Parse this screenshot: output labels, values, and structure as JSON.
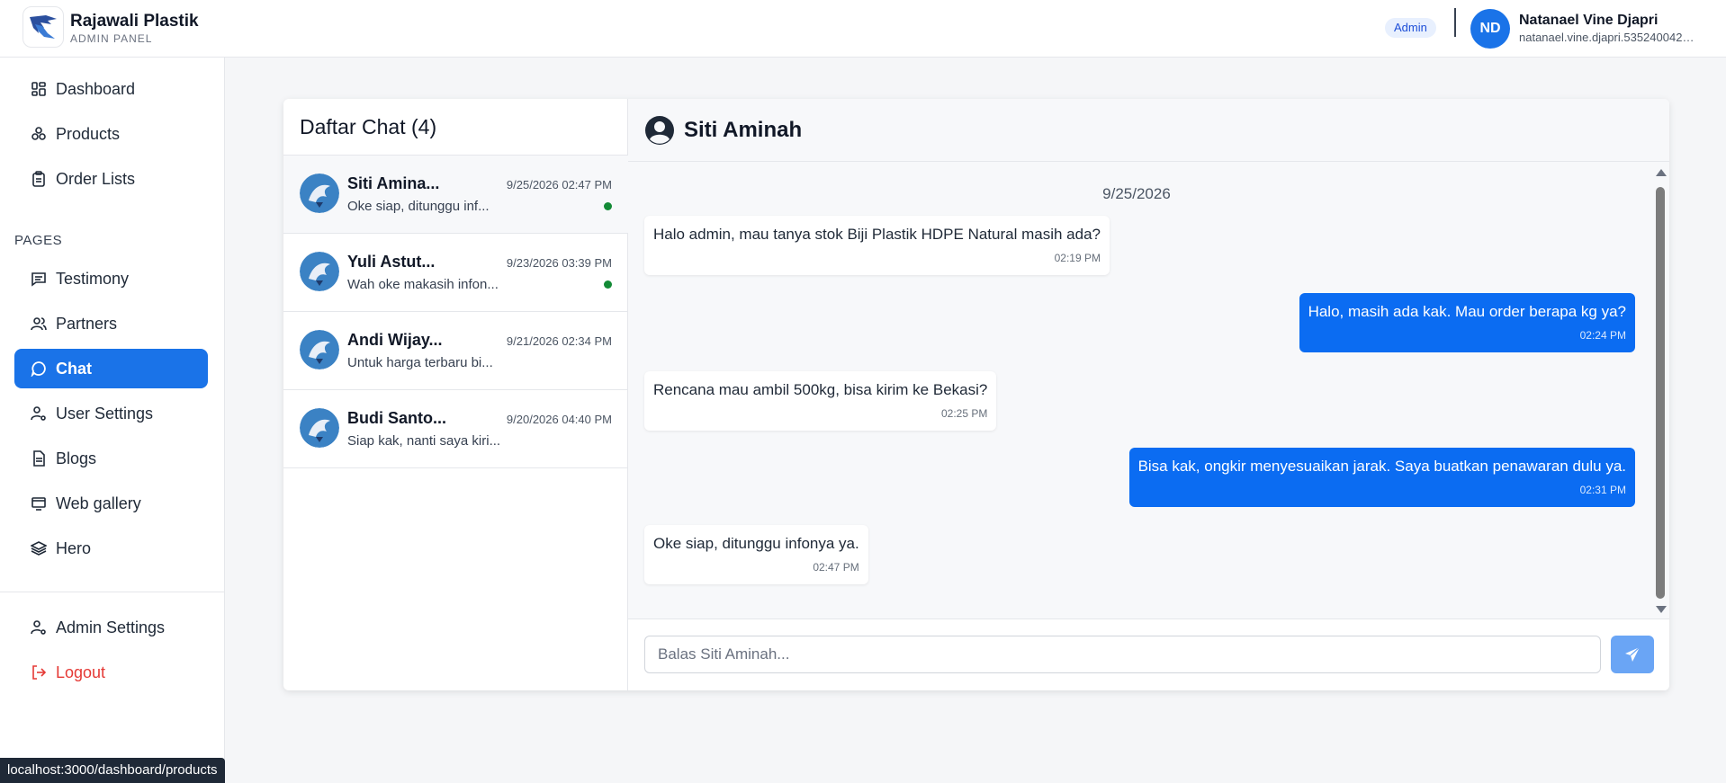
{
  "header": {
    "brand_name": "Rajawali Plastik",
    "brand_sub": "ADMIN PANEL",
    "role_badge": "Admin",
    "user_initials": "ND",
    "user_name": "Natanael Vine Djapri",
    "user_email": "natanael.vine.djapri.535240042@..."
  },
  "sidebar": {
    "main_items": [
      {
        "label": "Dashboard",
        "icon": "dashboard-icon"
      },
      {
        "label": "Products",
        "icon": "products-icon"
      },
      {
        "label": "Order Lists",
        "icon": "clipboard-icon"
      }
    ],
    "section_label": "PAGES",
    "page_items": [
      {
        "label": "Testimony",
        "icon": "message-square-icon"
      },
      {
        "label": "Partners",
        "icon": "users-icon"
      },
      {
        "label": "Chat",
        "icon": "chat-bubble-icon",
        "active": true
      },
      {
        "label": "User Settings",
        "icon": "user-cog-icon"
      },
      {
        "label": "Blogs",
        "icon": "document-icon"
      },
      {
        "label": "Web gallery",
        "icon": "monitor-icon"
      },
      {
        "label": "Hero",
        "icon": "layers-icon"
      }
    ],
    "bottom_items": [
      {
        "label": "Admin Settings",
        "icon": "user-cog-icon"
      },
      {
        "label": "Logout",
        "icon": "logout-icon"
      }
    ]
  },
  "chat_list": {
    "title": "Daftar Chat (4)",
    "items": [
      {
        "name": "Siti Amina...",
        "time": "9/25/2026 02:47 PM",
        "preview": "Oke siap, ditunggu inf...",
        "unread": true,
        "selected": true
      },
      {
        "name": "Yuli Astut...",
        "time": "9/23/2026 03:39 PM",
        "preview": "Wah oke makasih infon...",
        "unread": true,
        "selected": false
      },
      {
        "name": "Andi Wijay...",
        "time": "9/21/2026 02:34 PM",
        "preview": "Untuk harga terbaru bi...",
        "unread": false,
        "selected": false
      },
      {
        "name": "Budi Santo...",
        "time": "9/20/2026 04:40 PM",
        "preview": "Siap kak, nanti saya kiri...",
        "unread": false,
        "selected": false
      }
    ]
  },
  "conversation": {
    "title": "Siti Aminah",
    "date": "9/25/2026",
    "messages": [
      {
        "direction": "in",
        "text": "Halo admin, mau tanya stok Biji Plastik HDPE Natural masih ada?",
        "time": "02:19 PM"
      },
      {
        "direction": "out",
        "text": "Halo, masih ada kak. Mau order berapa kg ya?",
        "time": "02:24 PM"
      },
      {
        "direction": "in",
        "text": "Rencana mau ambil 500kg, bisa kirim ke Bekasi?",
        "time": "02:25 PM"
      },
      {
        "direction": "out",
        "text": "Bisa kak, ongkir menyesuaikan jarak. Saya buatkan penawaran dulu ya.",
        "time": "02:31 PM"
      },
      {
        "direction": "in",
        "text": "Oke siap, ditunggu infonya ya.",
        "time": "02:47 PM"
      }
    ],
    "reply_placeholder": "Balas Siti Aminah...",
    "reply_value": ""
  },
  "status_url": "localhost:3000/dashboard/products",
  "colors": {
    "accent": "#1a73e8",
    "outgoing_bubble": "#0b6cf2",
    "unread_dot": "#138a36",
    "logout": "#e53935"
  }
}
